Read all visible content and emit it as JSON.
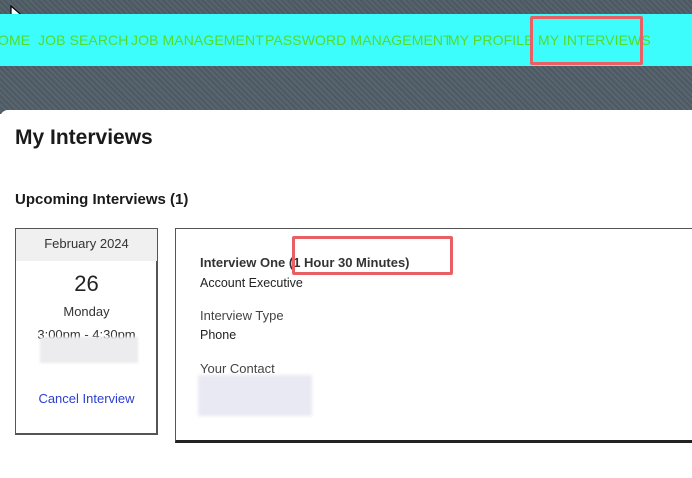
{
  "nav": {
    "items": [
      "OME",
      "JOB SEARCH",
      "JOB MANAGEMENT",
      "PASSWORD MANAGEMENT",
      "MY PROFILE",
      "MY INTERVIEWS"
    ],
    "active": "MY INTERVIEWS"
  },
  "page": {
    "title": "My Interviews",
    "section_title": "Upcoming Interviews (1)"
  },
  "interview": {
    "month": "February 2024",
    "day": "26",
    "weekday": "Monday",
    "time": "3:00pm - 4:30pm",
    "cancel_label": "Cancel Interview",
    "name": "Interview One",
    "duration": "(1 Hour 30 Minutes)",
    "position": "Account Executive",
    "type_label": "Interview Type",
    "type_value": "Phone",
    "contact_label": "Your Contact"
  },
  "colors": {
    "nav_bg": "#3dfcfc",
    "nav_text": "#52dc2a",
    "highlight": "#e86064",
    "link": "#2b3fcf"
  }
}
